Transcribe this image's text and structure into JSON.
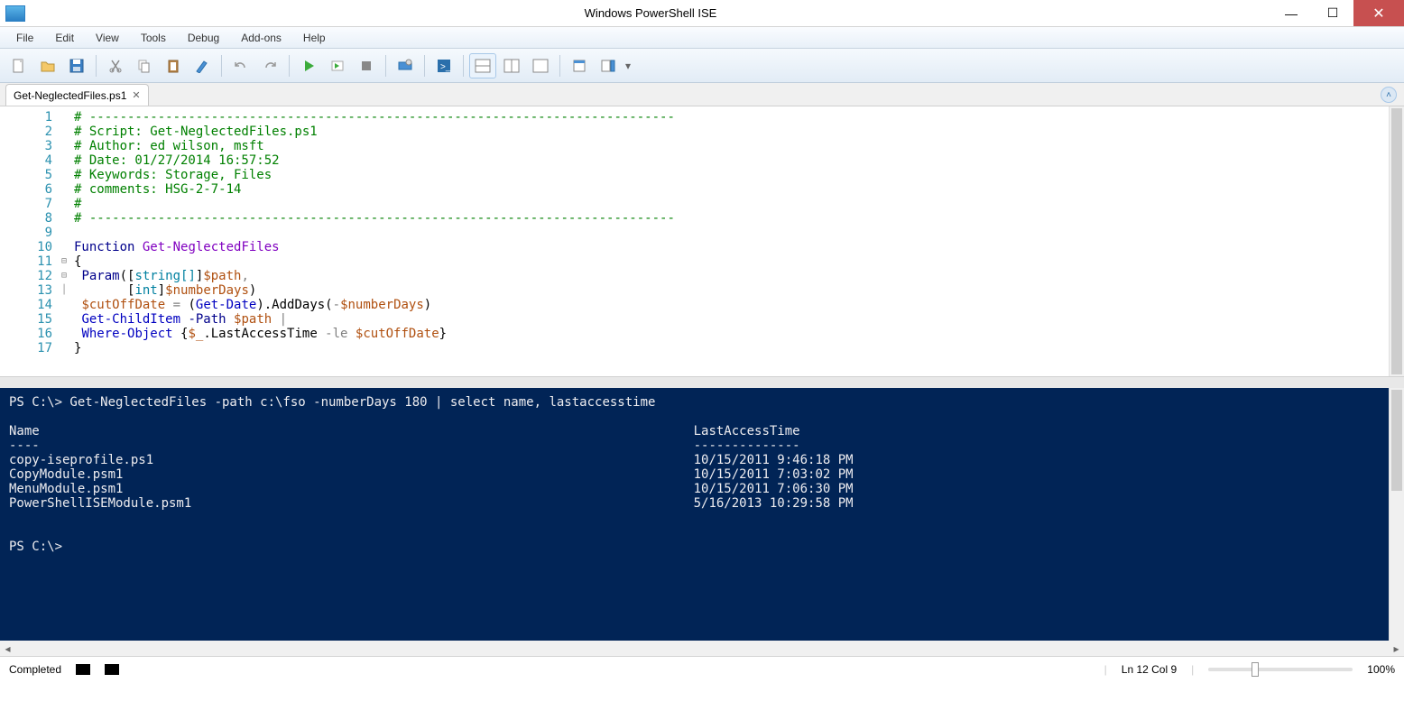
{
  "window": {
    "title": "Windows PowerShell ISE"
  },
  "menus": [
    "File",
    "Edit",
    "View",
    "Tools",
    "Debug",
    "Add-ons",
    "Help"
  ],
  "tab": {
    "label": "Get-NeglectedFiles.ps1"
  },
  "editor": {
    "lines": [
      {
        "n": 1,
        "html": "<span class='c-green'># -----------------------------------------------------------------------------</span>"
      },
      {
        "n": 2,
        "html": "<span class='c-green'># Script: Get-NeglectedFiles.ps1</span>"
      },
      {
        "n": 3,
        "html": "<span class='c-green'># Author: ed wilson, msft</span>"
      },
      {
        "n": 4,
        "html": "<span class='c-green'># Date: 01/27/2014 16:57:52</span>"
      },
      {
        "n": 5,
        "html": "<span class='c-green'># Keywords: Storage, Files</span>"
      },
      {
        "n": 6,
        "html": "<span class='c-green'># comments: HSG-2-7-14</span>"
      },
      {
        "n": 7,
        "html": "<span class='c-green'>#</span>"
      },
      {
        "n": 8,
        "html": "<span class='c-green'># -----------------------------------------------------------------------------</span>"
      },
      {
        "n": 9,
        "html": " "
      },
      {
        "n": 10,
        "html": "<span class='c-navy'>Function</span> <span class='c-purple'>Get-NeglectedFiles</span>"
      },
      {
        "n": 11,
        "html": "{",
        "fold": "⊟"
      },
      {
        "n": 12,
        "html": " <span class='c-navy'>Param</span>([<span class='c-type'>string[]</span>]<span class='c-var'>$path</span><span class='c-gray'>,</span>",
        "fold": "⊟"
      },
      {
        "n": 13,
        "html": "       [<span class='c-type'>int</span>]<span class='c-var'>$numberDays</span>)",
        "fold": "│"
      },
      {
        "n": 14,
        "html": " <span class='c-var'>$cutOffDate</span> <span class='c-gray'>=</span> (<span class='c-blue'>Get-Date</span>).AddDays(<span class='c-gray'>-</span><span class='c-var'>$numberDays</span>)"
      },
      {
        "n": 15,
        "html": " <span class='c-blue'>Get-ChildItem</span> <span class='c-navy'>-Path</span> <span class='c-var'>$path</span> <span class='c-gray'>|</span>"
      },
      {
        "n": 16,
        "html": " <span class='c-blue'>Where-Object</span> {<span class='c-var'>$_</span>.LastAccessTime <span class='c-gray'>-le</span> <span class='c-var'>$cutOffDate</span>}"
      },
      {
        "n": 17,
        "html": "}"
      }
    ]
  },
  "console": {
    "prompt1": "PS C:\\> Get-NeglectedFiles -path c:\\fso -numberDays 180 | select name, lastaccesstime",
    "header_name": "Name",
    "header_time": "LastAccessTime",
    "dash_name": "----",
    "dash_time": "--------------",
    "rows": [
      {
        "name": "copy-iseprofile.ps1",
        "time": "10/15/2011 9:46:18 PM"
      },
      {
        "name": "CopyModule.psm1",
        "time": "10/15/2011 7:03:02 PM"
      },
      {
        "name": "MenuModule.psm1",
        "time": "10/15/2011 7:06:30 PM"
      },
      {
        "name": "PowerShellISEModule.psm1",
        "time": "5/16/2013 10:29:58 PM"
      }
    ],
    "prompt2": "PS C:\\>"
  },
  "status": {
    "left": "Completed",
    "pos": "Ln 12  Col 9",
    "zoom": "100%"
  }
}
